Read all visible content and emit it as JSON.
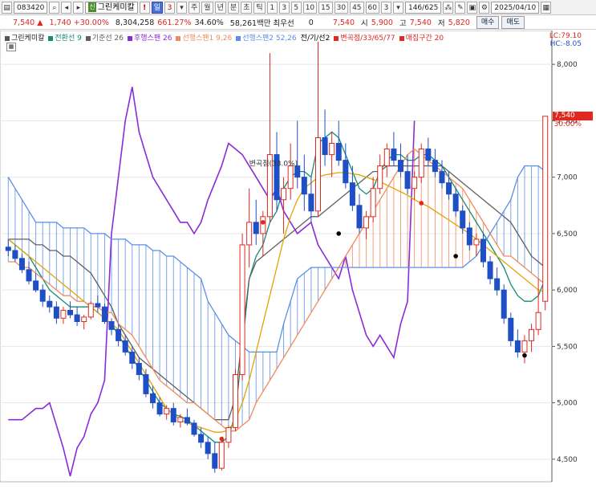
{
  "toolbar": {
    "code": "083420",
    "name": "그린케미칼",
    "name_badge": "신",
    "period_buttons": [
      "일",
      "3",
      "주",
      "월",
      "년",
      "분",
      "초",
      "틱",
      "1",
      "3",
      "5",
      "10",
      "15",
      "30",
      "45",
      "60",
      "3"
    ],
    "active_period": "일",
    "count": "146",
    "total": "/625",
    "date": "2025/04/10",
    "icons": [
      "chart-code-icon",
      "search-icon",
      "sound-icon",
      "link-icon",
      "info-icon",
      "dropdown-icon",
      "options-icon",
      "draw-icon",
      "print-icon",
      "settings-icon",
      "calendar-icon"
    ]
  },
  "quote": {
    "price": "7,540",
    "change": "1,740",
    "change_pct": "+30.00%",
    "volume": "8,304,258",
    "volume_pct": "661.27%",
    "turnover": "34.60%",
    "amount": "58,261백만",
    "best_bid_label": "최우선",
    "best_bid_value": "0",
    "best_ask_value": "7,540",
    "open_label": "시",
    "open": "5,900",
    "high_label": "고",
    "high": "7,540",
    "low_label": "저",
    "low": "5,820",
    "buy_button": "매수",
    "sell_button": "매도"
  },
  "colors": {
    "up": "#e0281f",
    "down": "#1f4fc5",
    "conversion": "#0f8c7a",
    "base": "#606060",
    "lagging": "#8a2bd8",
    "span1": "#f08a5a",
    "span2": "#5b8ee6",
    "ma": "#e5a300"
  },
  "legend": {
    "name": "그린케미칼",
    "conv_label": "전환선 9",
    "base_label": "기준선 26",
    "lag_label": "후행스팬 26",
    "span1_label": "선행스팬1 9,26",
    "span2_label": "선행스팬2 52,26",
    "cross_label": "전/기/선2",
    "change_label": "변곡점/33/65/77",
    "zone_label": "매집구간 20"
  },
  "lc_hc": {
    "lc": "LC:79.10",
    "hc": "HC:-8.05"
  },
  "current_tag": {
    "price": "7,540",
    "pct": "30.00%"
  },
  "annotation": "변곡점(33.0%)",
  "chart_data": {
    "type": "line",
    "title": "",
    "ylim": [
      4300,
      8300
    ],
    "yticks": [
      4500,
      5000,
      5500,
      6000,
      6500,
      7000,
      7500,
      8000
    ],
    "ytick_labels": [
      "4,500",
      "5,000",
      "5,500",
      "6,000",
      "6,500",
      "7,000",
      "7,500",
      "8,000"
    ],
    "candles": [
      {
        "o": 6380,
        "h": 6450,
        "l": 6300,
        "c": 6350
      },
      {
        "o": 6350,
        "h": 6400,
        "l": 6250,
        "c": 6280
      },
      {
        "o": 6280,
        "h": 6320,
        "l": 6150,
        "c": 6180
      },
      {
        "o": 6180,
        "h": 6250,
        "l": 6050,
        "c": 6080
      },
      {
        "o": 6080,
        "h": 6150,
        "l": 5980,
        "c": 6000
      },
      {
        "o": 6000,
        "h": 6050,
        "l": 5850,
        "c": 5900
      },
      {
        "o": 5900,
        "h": 5950,
        "l": 5800,
        "c": 5850
      },
      {
        "o": 5850,
        "h": 5900,
        "l": 5700,
        "c": 5750
      },
      {
        "o": 5750,
        "h": 5850,
        "l": 5700,
        "c": 5820
      },
      {
        "o": 5820,
        "h": 5900,
        "l": 5750,
        "c": 5780
      },
      {
        "o": 5780,
        "h": 5850,
        "l": 5680,
        "c": 5720
      },
      {
        "o": 5720,
        "h": 5780,
        "l": 5650,
        "c": 5760
      },
      {
        "o": 5760,
        "h": 5900,
        "l": 5740,
        "c": 5880
      },
      {
        "o": 5880,
        "h": 5950,
        "l": 5800,
        "c": 5850
      },
      {
        "o": 5850,
        "h": 5880,
        "l": 5700,
        "c": 5720
      },
      {
        "o": 5720,
        "h": 5750,
        "l": 5600,
        "c": 5650
      },
      {
        "o": 5650,
        "h": 5700,
        "l": 5500,
        "c": 5550
      },
      {
        "o": 5550,
        "h": 5600,
        "l": 5420,
        "c": 5450
      },
      {
        "o": 5450,
        "h": 5500,
        "l": 5300,
        "c": 5350
      },
      {
        "o": 5350,
        "h": 5400,
        "l": 5200,
        "c": 5250
      },
      {
        "o": 5250,
        "h": 5300,
        "l": 5050,
        "c": 5080
      },
      {
        "o": 5080,
        "h": 5150,
        "l": 4950,
        "c": 5000
      },
      {
        "o": 5000,
        "h": 5050,
        "l": 4880,
        "c": 4900
      },
      {
        "o": 4900,
        "h": 4980,
        "l": 4850,
        "c": 4950
      },
      {
        "o": 4950,
        "h": 5000,
        "l": 4800,
        "c": 4830
      },
      {
        "o": 4830,
        "h": 4900,
        "l": 4780,
        "c": 4870
      },
      {
        "o": 4870,
        "h": 4950,
        "l": 4800,
        "c": 4820
      },
      {
        "o": 4820,
        "h": 4850,
        "l": 4700,
        "c": 4720
      },
      {
        "o": 4720,
        "h": 4780,
        "l": 4600,
        "c": 4650
      },
      {
        "o": 4650,
        "h": 4700,
        "l": 4500,
        "c": 4550
      },
      {
        "o": 4550,
        "h": 4650,
        "l": 4380,
        "c": 4420
      },
      {
        "o": 4420,
        "h": 4700,
        "l": 4400,
        "c": 4650
      },
      {
        "o": 4650,
        "h": 4800,
        "l": 4600,
        "c": 4780
      },
      {
        "o": 4780,
        "h": 5300,
        "l": 4750,
        "c": 5250
      },
      {
        "o": 5250,
        "h": 6500,
        "l": 5200,
        "c": 6400
      },
      {
        "o": 6400,
        "h": 6900,
        "l": 6200,
        "c": 6600
      },
      {
        "o": 6600,
        "h": 6800,
        "l": 6400,
        "c": 6500
      },
      {
        "o": 6500,
        "h": 6700,
        "l": 6300,
        "c": 6650
      },
      {
        "o": 6650,
        "h": 8100,
        "l": 6600,
        "c": 7200
      },
      {
        "o": 7200,
        "h": 7400,
        "l": 6700,
        "c": 6800
      },
      {
        "o": 6800,
        "h": 7000,
        "l": 6500,
        "c": 6900
      },
      {
        "o": 6900,
        "h": 7300,
        "l": 6800,
        "c": 7100
      },
      {
        "o": 7100,
        "h": 7500,
        "l": 6900,
        "c": 7000
      },
      {
        "o": 7000,
        "h": 7200,
        "l": 6700,
        "c": 6850
      },
      {
        "o": 6850,
        "h": 7000,
        "l": 6600,
        "c": 6700
      },
      {
        "o": 6700,
        "h": 8200,
        "l": 6650,
        "c": 7350
      },
      {
        "o": 7350,
        "h": 7600,
        "l": 7100,
        "c": 7200
      },
      {
        "o": 7200,
        "h": 7400,
        "l": 7000,
        "c": 7300
      },
      {
        "o": 7300,
        "h": 7500,
        "l": 7100,
        "c": 7150
      },
      {
        "o": 7150,
        "h": 7300,
        "l": 6900,
        "c": 6950
      },
      {
        "o": 6950,
        "h": 7100,
        "l": 6700,
        "c": 6750
      },
      {
        "o": 6750,
        "h": 6850,
        "l": 6500,
        "c": 6550
      },
      {
        "o": 6550,
        "h": 6700,
        "l": 6450,
        "c": 6650
      },
      {
        "o": 6650,
        "h": 7000,
        "l": 6600,
        "c": 6900
      },
      {
        "o": 6900,
        "h": 7200,
        "l": 6850,
        "c": 7100
      },
      {
        "o": 7100,
        "h": 7300,
        "l": 7000,
        "c": 7250
      },
      {
        "o": 7250,
        "h": 7400,
        "l": 7100,
        "c": 7150
      },
      {
        "o": 7150,
        "h": 7300,
        "l": 7000,
        "c": 7050
      },
      {
        "o": 7050,
        "h": 7200,
        "l": 6850,
        "c": 6900
      },
      {
        "o": 6900,
        "h": 7050,
        "l": 6800,
        "c": 7000
      },
      {
        "o": 7000,
        "h": 7300,
        "l": 6950,
        "c": 7250
      },
      {
        "o": 7250,
        "h": 7350,
        "l": 7100,
        "c": 7150
      },
      {
        "o": 7150,
        "h": 7250,
        "l": 7000,
        "c": 7050
      },
      {
        "o": 7050,
        "h": 7150,
        "l": 6900,
        "c": 6950
      },
      {
        "o": 6950,
        "h": 7050,
        "l": 6800,
        "c": 6850
      },
      {
        "o": 6850,
        "h": 6900,
        "l": 6650,
        "c": 6700
      },
      {
        "o": 6700,
        "h": 6750,
        "l": 6500,
        "c": 6550
      },
      {
        "o": 6550,
        "h": 6600,
        "l": 6350,
        "c": 6400
      },
      {
        "o": 6400,
        "h": 6500,
        "l": 6300,
        "c": 6450
      },
      {
        "o": 6450,
        "h": 6500,
        "l": 6200,
        "c": 6250
      },
      {
        "o": 6250,
        "h": 6300,
        "l": 6050,
        "c": 6100
      },
      {
        "o": 6100,
        "h": 6200,
        "l": 5950,
        "c": 6000
      },
      {
        "o": 6000,
        "h": 6050,
        "l": 5700,
        "c": 5750
      },
      {
        "o": 5750,
        "h": 5800,
        "l": 5500,
        "c": 5550
      },
      {
        "o": 5550,
        "h": 5650,
        "l": 5400,
        "c": 5450
      },
      {
        "o": 5450,
        "h": 5600,
        "l": 5350,
        "c": 5550
      },
      {
        "o": 5550,
        "h": 5700,
        "l": 5450,
        "c": 5650
      },
      {
        "o": 5650,
        "h": 6100,
        "l": 5600,
        "c": 5800
      },
      {
        "o": 5900,
        "h": 7540,
        "l": 5820,
        "c": 7540
      }
    ],
    "series": [
      {
        "name": "전환선 9",
        "values": [
          6450,
          6400,
          6350,
          6300,
          6200,
          6100,
          6000,
          5950,
          5900,
          5850,
          5850,
          5850,
          5850,
          5800,
          5750,
          5700,
          5600,
          5500,
          5400,
          5300,
          5200,
          5100,
          5000,
          4950,
          4900,
          4880,
          4850,
          4800,
          4750,
          4700,
          4650,
          4650,
          4700,
          4900,
          5500,
          6100,
          6300,
          6400,
          6600,
          6700,
          6900,
          7000,
          7050,
          7050,
          7000,
          7300,
          7350,
          7400,
          7350,
          7200,
          7050,
          6900,
          6850,
          6900,
          7050,
          7150,
          7200,
          7200,
          7150,
          7150,
          7200,
          7200,
          7150,
          7100,
          7000,
          6900,
          6800,
          6700,
          6600,
          6500,
          6400,
          6300,
          6200,
          6050,
          5950,
          5900,
          5900,
          5950,
          6100
        ]
      },
      {
        "name": "기준선 26",
        "values": [
          6450,
          6450,
          6450,
          6450,
          6400,
          6400,
          6350,
          6350,
          6300,
          6300,
          6250,
          6200,
          6150,
          6050,
          5950,
          5850,
          5700,
          5600,
          5500,
          5400,
          5350,
          5300,
          5250,
          5200,
          5150,
          5100,
          5050,
          5000,
          4950,
          4900,
          4850,
          4850,
          4850,
          5050,
          5600,
          6100,
          6250,
          6300,
          6350,
          6400,
          6450,
          6500,
          6550,
          6600,
          6650,
          6650,
          6700,
          6750,
          6800,
          6850,
          6900,
          6950,
          7000,
          7050,
          7050,
          7100,
          7100,
          7100,
          7100,
          7100,
          7100,
          7100,
          7100,
          7100,
          7050,
          7000,
          6950,
          6900,
          6850,
          6800,
          6750,
          6700,
          6650,
          6600,
          6500,
          6400,
          6300,
          6250,
          6200
        ]
      },
      {
        "name": "후행스팬 26",
        "values": [
          4850,
          4850,
          4850,
          4900,
          4950,
          4950,
          5000,
          4800,
          4600,
          4350,
          4600,
          4700,
          4900,
          5000,
          5200,
          6500,
          7000,
          7500,
          7800,
          7400,
          7200,
          7000,
          6900,
          6800,
          6700,
          6600,
          6600,
          6500,
          6600,
          6800,
          6950,
          7100,
          7300,
          7250,
          7200,
          7100,
          7000,
          6900,
          6800,
          6900,
          6700,
          6600,
          6500,
          6550,
          6600,
          6400,
          6300,
          6200,
          6100,
          6300,
          6000,
          5800,
          5600,
          5500,
          5600,
          5500,
          5400,
          5700,
          5900,
          7500,
          null,
          null,
          null,
          null,
          null,
          null,
          null,
          null,
          null,
          null,
          null,
          null,
          null,
          null,
          null,
          null,
          null,
          null,
          null
        ]
      },
      {
        "name": "MA",
        "values": [
          6450,
          6400,
          6350,
          6300,
          6250,
          6200,
          6150,
          6100,
          6050,
          6000,
          5950,
          5900,
          5850,
          5800,
          5750,
          5700,
          5650,
          5550,
          5450,
          5350,
          5250,
          5150,
          5050,
          4950,
          4900,
          4850,
          4820,
          4800,
          4780,
          4760,
          4740,
          4740,
          4760,
          4850,
          5000,
          5200,
          5450,
          5700,
          5950,
          6200,
          6450,
          6650,
          6800,
          6900,
          6950,
          7000,
          7020,
          7030,
          7040,
          7040,
          7030,
          7020,
          7000,
          6980,
          6960,
          6930,
          6900,
          6870,
          6840,
          6800,
          6770,
          6740,
          6700,
          6660,
          6620,
          6580,
          6540,
          6500,
          6450,
          6400,
          6350,
          6300,
          6250,
          6200,
          6150,
          6100,
          6050,
          6000,
          5980
        ]
      },
      {
        "name": "선행스팬1 9,26",
        "values": [
          6250,
          6250,
          6200,
          6200,
          6150,
          6100,
          6050,
          6000,
          5950,
          5950,
          5900,
          5900,
          5850,
          5850,
          5800,
          5800,
          5700,
          5650,
          5600,
          5500,
          5400,
          5300,
          5200,
          5150,
          5100,
          5050,
          5000,
          5000,
          4950,
          4900,
          4850,
          4800,
          4750,
          4750,
          4800,
          4850,
          5000,
          5100,
          5200,
          5300,
          5400,
          5500,
          5600,
          5700,
          5800,
          5900,
          6000,
          6100,
          6200,
          6300,
          6400,
          6500,
          6600,
          6700,
          6800,
          6900,
          7000,
          7100,
          7200,
          7250,
          7200,
          7150,
          7100,
          7050,
          7000,
          6950,
          6900,
          6800,
          6700,
          6600,
          6500,
          6400,
          6300,
          6300,
          6250,
          6200,
          6150,
          6100,
          6050
        ]
      },
      {
        "name": "선행스팬2 52,26",
        "values": [
          7000,
          6900,
          6800,
          6700,
          6600,
          6600,
          6600,
          6600,
          6550,
          6550,
          6550,
          6550,
          6500,
          6500,
          6500,
          6450,
          6450,
          6450,
          6400,
          6400,
          6400,
          6350,
          6350,
          6300,
          6300,
          6250,
          6200,
          6150,
          6100,
          5900,
          5800,
          5700,
          5600,
          5550,
          5500,
          5450,
          5450,
          5450,
          5450,
          5450,
          5700,
          5900,
          6100,
          6150,
          6200,
          6200,
          6200,
          6200,
          6200,
          6200,
          6200,
          6200,
          6200,
          6200,
          6200,
          6200,
          6200,
          6200,
          6200,
          6200,
          6200,
          6200,
          6200,
          6200,
          6200,
          6200,
          6200,
          6250,
          6300,
          6400,
          6500,
          6600,
          6700,
          6800,
          7000,
          7100,
          7100,
          7100,
          7050
        ]
      }
    ],
    "markers": [
      {
        "i": 31,
        "v": 4680,
        "color": "#e0281f"
      },
      {
        "i": 37,
        "v": 6600,
        "color": "#e0281f"
      },
      {
        "i": 48,
        "v": 6500,
        "color": "#000000"
      },
      {
        "i": 60,
        "v": 6770,
        "color": "#e0281f"
      },
      {
        "i": 65,
        "v": 6300,
        "color": "#000000"
      },
      {
        "i": 75,
        "v": 5420,
        "color": "#000000"
      }
    ]
  }
}
